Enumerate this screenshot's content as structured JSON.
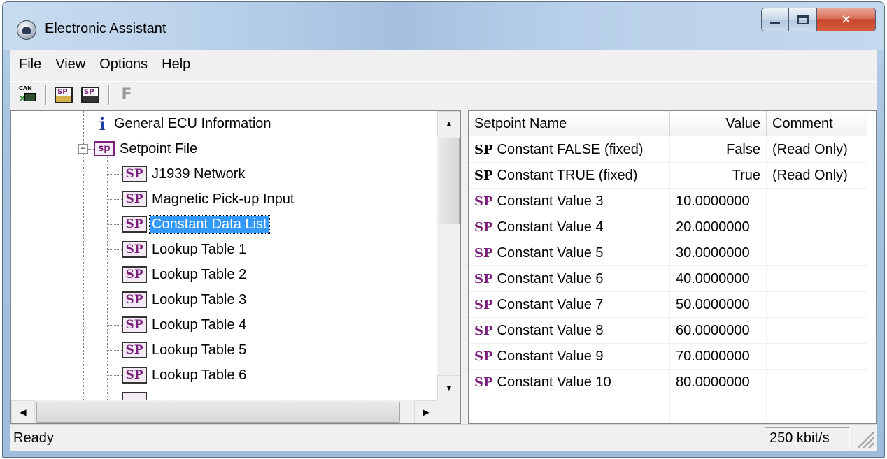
{
  "window": {
    "title": "Electronic Assistant",
    "icon": "app-logo-icon"
  },
  "menu": [
    "File",
    "View",
    "Options",
    "Help"
  ],
  "toolbar": {
    "buttons": [
      {
        "name": "can-connect-button",
        "icon": "can-network-icon",
        "label": "CAN"
      },
      {
        "name": "open-setpoint-button",
        "icon": "sp-open-icon",
        "label": "SP"
      },
      {
        "name": "save-setpoint-button",
        "icon": "sp-save-icon",
        "label": "SP"
      },
      {
        "name": "f-button",
        "icon": "f-icon",
        "label": "F",
        "enabled": false
      }
    ]
  },
  "tree": {
    "items": [
      {
        "label": "General ECU Information",
        "icon": "info-icon",
        "level": 2
      },
      {
        "label": "Setpoint File",
        "icon": "setpoint-file-icon",
        "level": 1,
        "expanded": true
      },
      {
        "label": "J1939 Network",
        "icon": "sp-icon",
        "level": 2
      },
      {
        "label": "Magnetic Pick-up Input",
        "icon": "sp-icon",
        "level": 2
      },
      {
        "label": "Constant Data List",
        "icon": "sp-icon",
        "level": 2,
        "selected": true
      },
      {
        "label": "Lookup Table 1",
        "icon": "sp-icon",
        "level": 2
      },
      {
        "label": "Lookup Table 2",
        "icon": "sp-icon",
        "level": 2
      },
      {
        "label": "Lookup Table 3",
        "icon": "sp-icon",
        "level": 2
      },
      {
        "label": "Lookup Table 4",
        "icon": "sp-icon",
        "level": 2
      },
      {
        "label": "Lookup Table 5",
        "icon": "sp-icon",
        "level": 2
      },
      {
        "label": "Lookup Table 6",
        "icon": "sp-icon",
        "level": 2
      }
    ],
    "sp_badge": "SP",
    "sp_file_badge": "sp",
    "info_glyph": "i"
  },
  "grid": {
    "columns": [
      "Setpoint Name",
      "Value",
      "Comment"
    ],
    "sp_tag": "SP",
    "rows": [
      {
        "name": "Constant FALSE (fixed)",
        "value": "False",
        "comment": "(Read Only)",
        "fixed": true
      },
      {
        "name": "Constant TRUE (fixed)",
        "value": "True",
        "comment": "(Read Only)",
        "fixed": true
      },
      {
        "name": "Constant Value 3",
        "value": "10.0000000",
        "comment": "",
        "fixed": false
      },
      {
        "name": "Constant Value 4",
        "value": "20.0000000",
        "comment": "",
        "fixed": false
      },
      {
        "name": "Constant Value 5",
        "value": "30.0000000",
        "comment": "",
        "fixed": false
      },
      {
        "name": "Constant Value 6",
        "value": "40.0000000",
        "comment": "",
        "fixed": false
      },
      {
        "name": "Constant Value 7",
        "value": "50.0000000",
        "comment": "",
        "fixed": false
      },
      {
        "name": "Constant Value 8",
        "value": "60.0000000",
        "comment": "",
        "fixed": false
      },
      {
        "name": "Constant Value 9",
        "value": "70.0000000",
        "comment": "",
        "fixed": false
      },
      {
        "name": "Constant Value 10",
        "value": "80.0000000",
        "comment": "",
        "fixed": false
      }
    ]
  },
  "status": {
    "text": "Ready",
    "baud": "250 kbit/s"
  },
  "colors": {
    "selection": "#3399ff",
    "sp_purple": "#7a1f7a",
    "info_blue": "#1a3fa8",
    "close_red": "#c7452b"
  }
}
